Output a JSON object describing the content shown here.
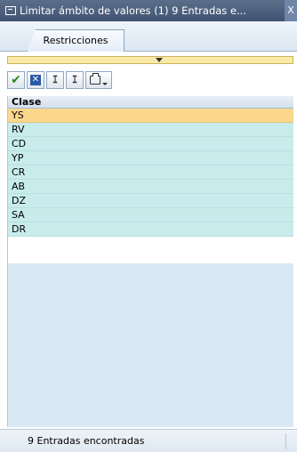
{
  "window": {
    "title": "Limitar ámbito de valores (1)   9 Entradas e...",
    "close_label": "X"
  },
  "tabs": [
    {
      "label": "Restricciones"
    }
  ],
  "toolbar": {
    "buttons": [
      {
        "icon": "checkmark-icon",
        "label": "✔"
      },
      {
        "icon": "cancel-icon",
        "label": "✕"
      },
      {
        "icon": "find-icon",
        "label": "🔍"
      },
      {
        "icon": "find-next-icon",
        "label": "⊕"
      },
      {
        "icon": "print-icon",
        "label": ""
      }
    ]
  },
  "grid": {
    "column_header": "Clase",
    "rows": [
      "YS",
      "RV",
      "CD",
      "YP",
      "CR",
      "AB",
      "DZ",
      "SA",
      "DR"
    ],
    "selected_index": 0
  },
  "status": {
    "text": "9 Entradas encontradas"
  },
  "colors": {
    "selected_row": "#fcd78e",
    "row": "#c8ecec",
    "empty_area": "#d9e9f4",
    "title_bar": "#4a5e7d"
  }
}
